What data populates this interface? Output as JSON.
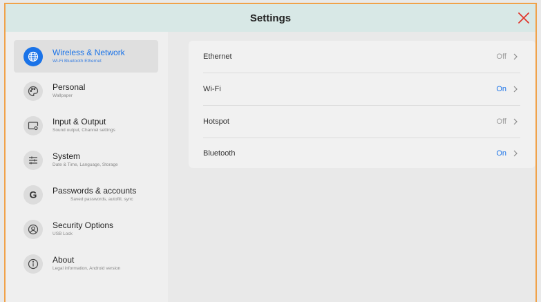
{
  "window": {
    "title": "Settings"
  },
  "colors": {
    "accent": "#1a73e8",
    "close": "#e0352b",
    "title_bar": "#d8e8e6"
  },
  "sidebar": {
    "items": [
      {
        "label": "Wireless & Network",
        "sub": "Wi-Fi Bluetooth Ethernet",
        "icon": "globe-icon",
        "active": true
      },
      {
        "label": "Personal",
        "sub": "Wallpaper",
        "icon": "palette-icon",
        "active": false
      },
      {
        "label": "Input & Output",
        "sub": "Sound output, Channel settings",
        "icon": "input-source-icon",
        "active": false
      },
      {
        "label": "System",
        "sub": "Date & Time, Language, Storage",
        "icon": "sliders-icon",
        "active": false
      },
      {
        "label": "Passwords & accounts",
        "sub": "Saved passwords, autofill, sync",
        "icon": "google-icon",
        "active": false
      },
      {
        "label": "Security Options",
        "sub": "USB Lock",
        "icon": "security-icon",
        "active": false
      },
      {
        "label": "About",
        "sub": "Legal information, Android version",
        "icon": "info-icon",
        "active": false
      }
    ]
  },
  "main": {
    "rows": [
      {
        "label": "Ethernet",
        "value": "Off",
        "state": "off"
      },
      {
        "label": "Wi-Fi",
        "value": "On",
        "state": "on"
      },
      {
        "label": "Hotspot",
        "value": "Off",
        "state": "off"
      },
      {
        "label": "Bluetooth",
        "value": "On",
        "state": "on"
      }
    ]
  }
}
